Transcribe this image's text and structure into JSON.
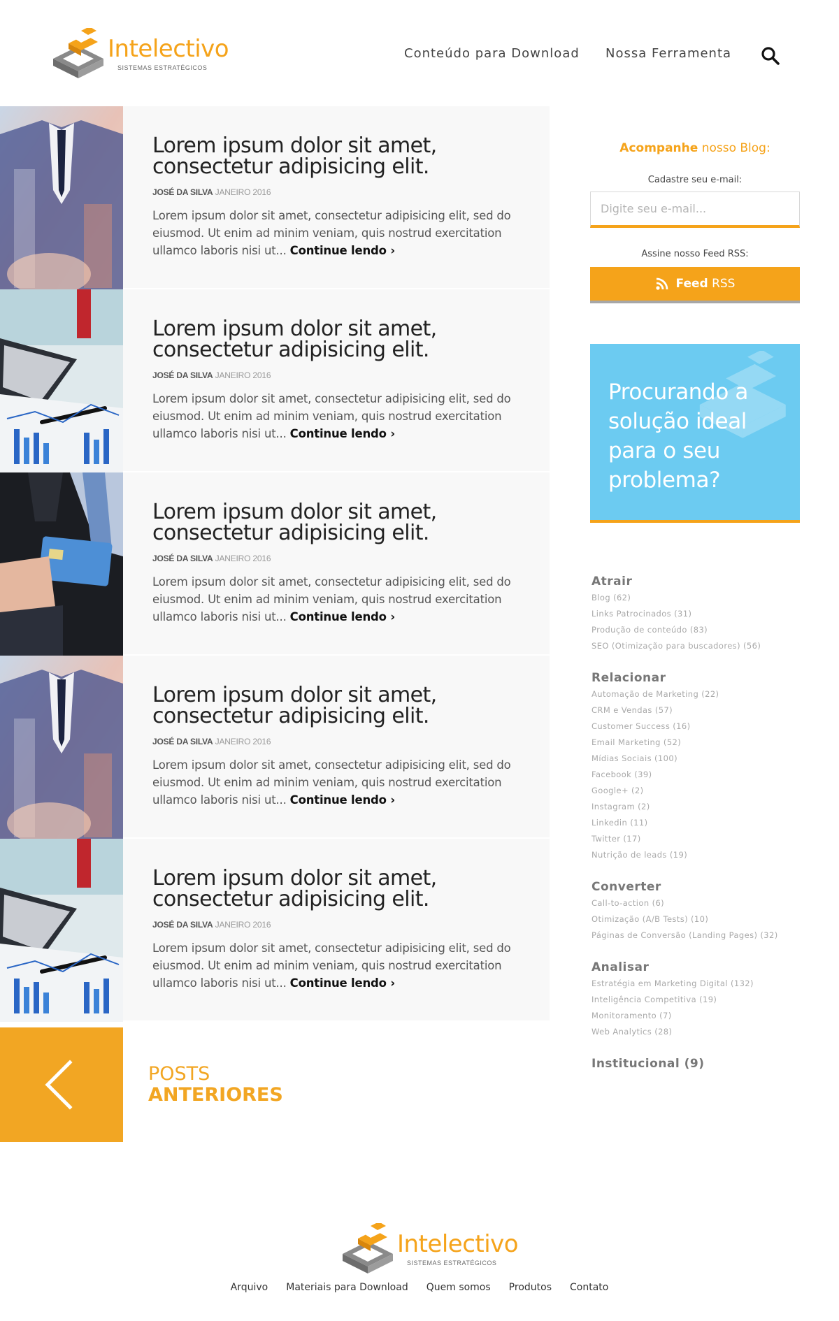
{
  "header": {
    "logo_name": "Intelectivo",
    "logo_sub": "SISTEMAS ESTRATÉGICOS",
    "nav": [
      "Conteúdo para Download",
      "Nossa Ferramenta"
    ]
  },
  "posts": [
    {
      "image": "business-suit-photo",
      "title_line1": "Lorem ipsum dolor sit amet,",
      "title_line2": "consectetur adipisicing elit.",
      "author": "JOSÉ DA SILVA",
      "date": "JANEIRO 2016",
      "excerpt": "Lorem ipsum dolor sit amet, consectetur adipisicing elit, sed do eiusmod. Ut enim ad minim veniam, quis nostrud exercitation ullamco laboris nisi ut...",
      "more": "Continue lendo ›"
    },
    {
      "image": "laptop-charts-photo",
      "title_line1": "Lorem ipsum dolor sit amet,",
      "title_line2": "consectetur adipisicing elit.",
      "author": "JOSÉ DA SILVA",
      "date": "JANEIRO 2016",
      "excerpt": "Lorem ipsum dolor sit amet, consectetur adipisicing elit, sed do eiusmod. Ut enim ad minim veniam, quis nostrud exercitation ullamco laboris nisi ut...",
      "more": "Continue lendo ›"
    },
    {
      "image": "credit-card-photo",
      "title_line1": "Lorem ipsum dolor sit amet,",
      "title_line2": "consectetur adipisicing elit.",
      "author": "JOSÉ DA SILVA",
      "date": "JANEIRO 2016",
      "excerpt": "Lorem ipsum dolor sit amet, consectetur adipisicing elit, sed do eiusmod. Ut enim ad minim veniam, quis nostrud exercitation ullamco laboris nisi ut...",
      "more": "Continue lendo ›"
    },
    {
      "image": "business-suit-photo",
      "title_line1": "Lorem ipsum dolor sit amet,",
      "title_line2": "consectetur adipisicing elit.",
      "author": "JOSÉ DA SILVA",
      "date": "JANEIRO 2016",
      "excerpt": "Lorem ipsum dolor sit amet, consectetur adipisicing elit, sed do eiusmod. Ut enim ad minim veniam, quis nostrud exercitation ullamco laboris nisi ut...",
      "more": "Continue lendo ›"
    },
    {
      "image": "laptop-charts-photo",
      "title_line1": "Lorem ipsum dolor sit amet,",
      "title_line2": "consectetur adipisicing elit.",
      "author": "JOSÉ DA SILVA",
      "date": "JANEIRO 2016",
      "excerpt": "Lorem ipsum dolor sit amet, consectetur adipisicing elit, sed do eiusmod. Ut enim ad minim veniam, quis nostrud exercitation ullamco laboris nisi ut...",
      "more": "Continue lendo ›"
    }
  ],
  "prev": {
    "line1": "POSTS",
    "line2": "ANTERIORES"
  },
  "sidebar": {
    "follow_bold": "Acompanhe",
    "follow_rest": " nosso Blog:",
    "email_label": "Cadastre seu e-mail:",
    "email_placeholder": "Digite seu e-mail...",
    "rss_label": "Assine nosso Feed RSS:",
    "rss_bold": "Feed",
    "rss_rest": "RSS",
    "promo": "Procurando a solução ideal para o seu problema?",
    "categories": [
      {
        "title": "Atrair",
        "items": [
          "Blog (62)",
          "Links Patrocinados (31)",
          "Produção de conteúdo (83)",
          "SEO (Otimização para buscadores) (56)"
        ]
      },
      {
        "title": "Relacionar",
        "items": [
          "Automação de Marketing (22)",
          "CRM e Vendas (57)",
          "Customer Success (16)",
          "Email Marketing (52)",
          "Mídias Sociais (100)",
          "Facebook (39)",
          "Google+ (2)",
          "Instagram (2)",
          "Linkedin (11)",
          "Twitter (17)",
          "Nutrição de leads (19)"
        ]
      },
      {
        "title": "Converter",
        "items": [
          "Call-to-action (6)",
          "Otimização (A/B Tests) (10)",
          "Páginas de Conversão (Landing Pages) (32)"
        ]
      },
      {
        "title": "Analisar",
        "items": [
          "Estratégia em Marketing Digital (132)",
          "Inteligência Competitiva (19)",
          "Monitoramento (7)",
          "Web Analytics (28)"
        ]
      },
      {
        "title": "Institucional (9)",
        "items": []
      }
    ]
  },
  "footer": {
    "links": [
      "Arquivo",
      "Materiais para Download",
      "Quem somos",
      "Produtos",
      "Contato"
    ]
  },
  "colors": {
    "accent": "#f5a31a",
    "promo_bg": "#6ccbf1",
    "post_bg": "#f8f8f8"
  },
  "icons": {
    "search": "search-icon",
    "rss": "rss-icon",
    "prev": "chevron-left-icon"
  }
}
